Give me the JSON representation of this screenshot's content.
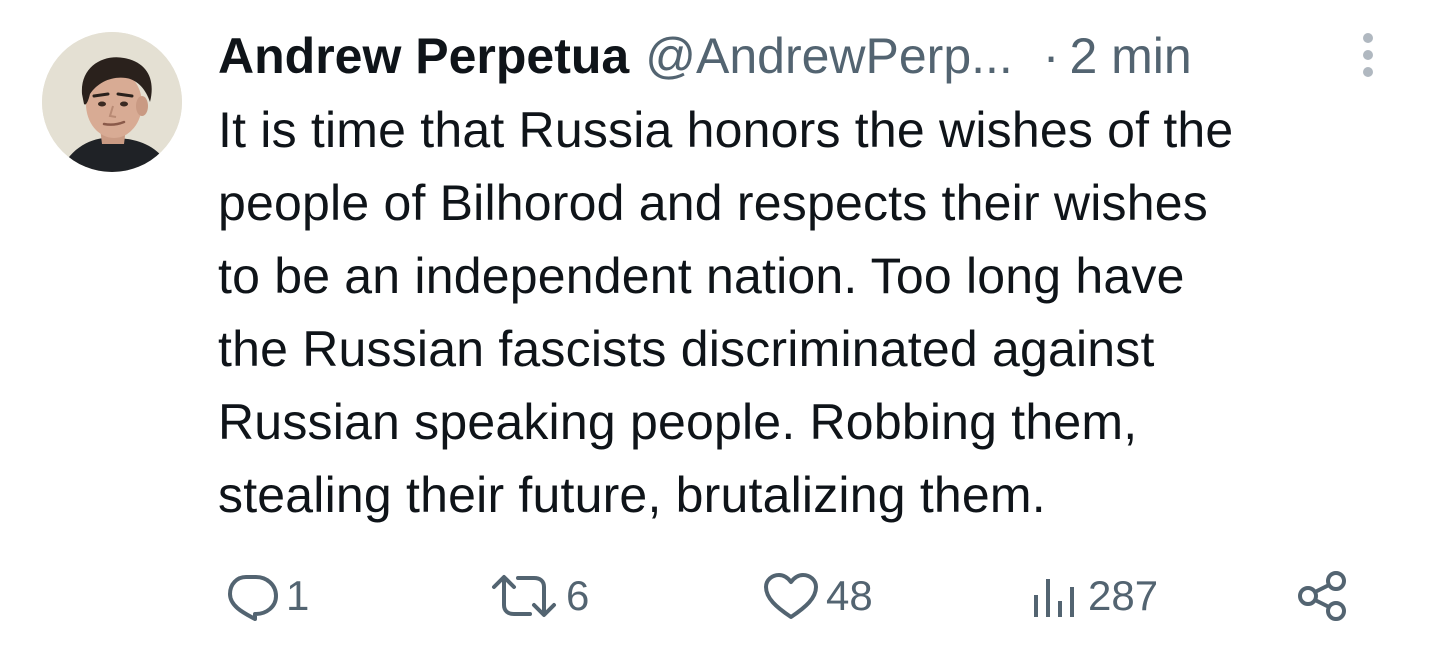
{
  "tweet": {
    "author": {
      "display_name": "Andrew Perpetua",
      "handle": "@AndrewPerp...",
      "avatar": "profile-photo"
    },
    "separator": "·",
    "timestamp": "2 min",
    "more_icon": "vertical-ellipsis-icon",
    "text_lines": [
      "It is time that Russia honors the wishes of the",
      "people of Bilhorod and respects their wishes",
      "to be an independent nation. Too long have",
      "the Russian fascists discriminated against",
      "Russian speaking people. Robbing them,",
      "stealing their future, brutalizing them."
    ],
    "actions": {
      "reply": {
        "icon": "reply-icon",
        "count": "1"
      },
      "retweet": {
        "icon": "retweet-icon",
        "count": "6"
      },
      "like": {
        "icon": "heart-icon",
        "count": "48"
      },
      "views": {
        "icon": "views-bar-chart-icon",
        "count": "287"
      },
      "share": {
        "icon": "share-icon"
      }
    }
  },
  "colors": {
    "text_primary": "#0f1419",
    "text_secondary": "#536471",
    "background": "#ffffff"
  }
}
